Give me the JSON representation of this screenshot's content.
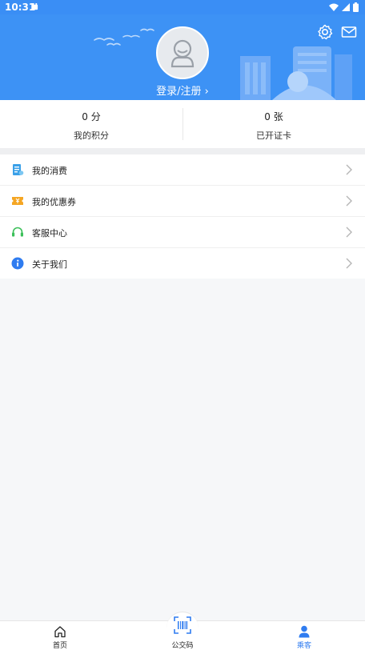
{
  "status": {
    "time": "10:31"
  },
  "header": {
    "login_text": "登录/注册 ›"
  },
  "stats": [
    {
      "value": "0 分",
      "label": "我的积分"
    },
    {
      "value": "0 张",
      "label": "已开证卡"
    }
  ],
  "menu": [
    {
      "label": "我的消费",
      "icon": "receipt-icon",
      "color": "#3aa0e8"
    },
    {
      "label": "我的优惠券",
      "icon": "coupon-icon",
      "color": "#f5a623"
    },
    {
      "label": "客服中心",
      "icon": "headset-icon",
      "color": "#3cc05a"
    },
    {
      "label": "关于我们",
      "icon": "info-icon",
      "color": "#2f7cf0"
    }
  ],
  "tabs": [
    {
      "label": "首页",
      "icon": "home-icon"
    },
    {
      "label": "公交码",
      "icon": "barcode-icon"
    },
    {
      "label": "乘客",
      "icon": "user-icon"
    }
  ],
  "colors": {
    "primary": "#3d92f5",
    "active_tab": "#2f7cf0"
  }
}
